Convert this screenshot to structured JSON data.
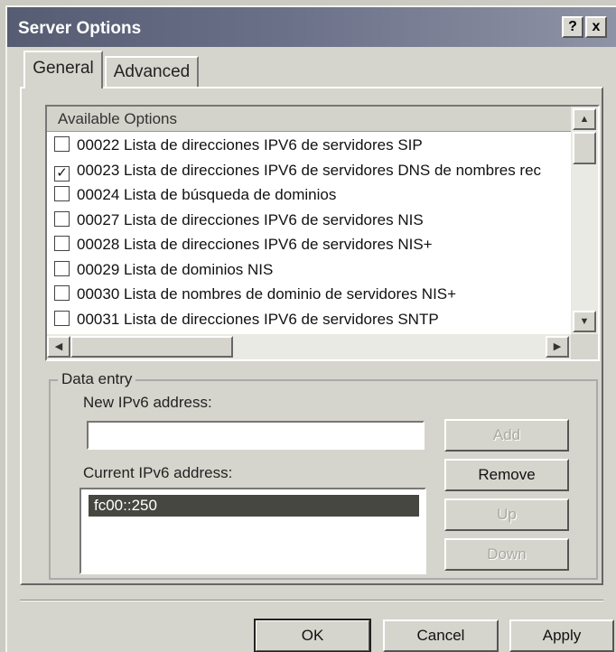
{
  "window": {
    "title": "Server Options",
    "help_glyph": "?",
    "close_glyph": "x"
  },
  "tabs": [
    {
      "label": "General",
      "active": true
    },
    {
      "label": "Advanced",
      "active": false
    }
  ],
  "available_options": {
    "header": "Available Options",
    "items": [
      {
        "text": "00022 Lista de direcciones IPV6 de servidores SIP",
        "checked": false
      },
      {
        "text": "00023 Lista de direcciones IPV6 de servidores DNS de nombres rec",
        "checked": true
      },
      {
        "text": "00024 Lista de búsqueda de dominios",
        "checked": false
      },
      {
        "text": "00027 Lista de direcciones IPV6 de servidores NIS",
        "checked": false
      },
      {
        "text": "00028 Lista de direcciones IPV6 de servidores NIS+",
        "checked": false
      },
      {
        "text": "00029 Lista de dominios NIS",
        "checked": false
      },
      {
        "text": "00030 Lista de nombres de dominio de servidores NIS+",
        "checked": false
      },
      {
        "text": "00031 Lista de direcciones IPV6 de servidores SNTP",
        "checked": false
      }
    ]
  },
  "data_entry": {
    "legend": "Data entry",
    "new_label": "New IPv6 address:",
    "new_value": "",
    "current_label": "Current IPv6 address:",
    "current_items": [
      "fc00::250"
    ],
    "buttons": {
      "add": "Add",
      "remove": "Remove",
      "up": "Up",
      "down": "Down"
    }
  },
  "footer": {
    "ok": "OK",
    "cancel": "Cancel",
    "apply": "Apply"
  }
}
